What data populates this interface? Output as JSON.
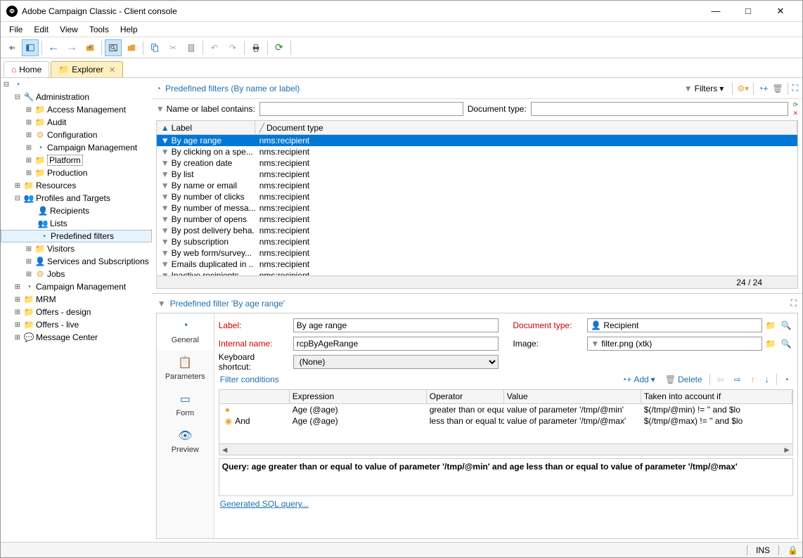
{
  "window": {
    "title": "Adobe Campaign Classic - Client console"
  },
  "menu": {
    "file": "File",
    "edit": "Edit",
    "view": "View",
    "tools": "Tools",
    "help": "Help"
  },
  "tabs": {
    "home": "Home",
    "explorer": "Explorer"
  },
  "tree": {
    "administration": "Administration",
    "access_management": "Access Management",
    "audit": "Audit",
    "configuration": "Configuration",
    "campaign_management": "Campaign Management",
    "platform": "Platform",
    "production": "Production",
    "resources": "Resources",
    "profiles_targets": "Profiles and Targets",
    "recipients": "Recipients",
    "lists": "Lists",
    "predefined_filters": "Predefined filters",
    "visitors": "Visitors",
    "services_subscriptions": "Services and Subscriptions",
    "jobs": "Jobs",
    "campaign_management2": "Campaign Management",
    "mrm": "MRM",
    "offers_design": "Offers - design",
    "offers_live": "Offers - live",
    "message_center": "Message Center"
  },
  "panel": {
    "title": "Predefined filters (By name or label)",
    "filters_btn": "Filters",
    "search_label": "Name or label contains:",
    "doctype_label": "Document type:"
  },
  "list": {
    "col_label": "Label",
    "col_doctype": "Document type",
    "footer_count": "24 / 24",
    "rows": [
      {
        "label": "By age range",
        "doctype": "nms:recipient",
        "selected": true
      },
      {
        "label": "By clicking on a spe...",
        "doctype": "nms:recipient"
      },
      {
        "label": "By creation date",
        "doctype": "nms:recipient"
      },
      {
        "label": "By list",
        "doctype": "nms:recipient"
      },
      {
        "label": "By name or email",
        "doctype": "nms:recipient"
      },
      {
        "label": "By number of clicks",
        "doctype": "nms:recipient"
      },
      {
        "label": "By number of messa...",
        "doctype": "nms:recipient"
      },
      {
        "label": "By number of opens",
        "doctype": "nms:recipient"
      },
      {
        "label": "By post delivery beha..",
        "doctype": "nms:recipient"
      },
      {
        "label": "By subscription",
        "doctype": "nms:recipient"
      },
      {
        "label": "By web form/survey...",
        "doctype": "nms:recipient"
      },
      {
        "label": "Emails duplicated in ..",
        "doctype": "nms:recipient"
      },
      {
        "label": "Inactive recipients",
        "doctype": "nms:recipient"
      }
    ]
  },
  "detail": {
    "header": "Predefined filter 'By age range'",
    "tabs": {
      "general": "General",
      "parameters": "Parameters",
      "form": "Form",
      "preview": "Preview"
    },
    "label_lbl": "Label:",
    "label_val": "By age range",
    "internal_lbl": "Internal name:",
    "internal_val": "rcpByAgeRange",
    "doctype_lbl": "Document type:",
    "doctype_val": "Recipient",
    "image_lbl": "Image:",
    "image_val": "filter.png (xtk)",
    "shortcut_lbl": "Keyboard shortcut:",
    "shortcut_val": "(None)",
    "filter_cond_title": "Filter conditions",
    "add_btn": "Add",
    "delete_btn": "Delete",
    "cond_cols": {
      "andor": "",
      "expr": "Expression",
      "op": "Operator",
      "val": "Value",
      "taken": "Taken into account if"
    },
    "cond_rows": [
      {
        "andor": "",
        "expr": "Age (@age)",
        "op": "greater than or equa",
        "val": "value of parameter '/tmp/@min'",
        "taken": "$(/tmp/@min) != '' and $lo"
      },
      {
        "andor": "And",
        "expr": "Age (@age)",
        "op": "less than or equal to",
        "val": "value of parameter '/tmp/@max'",
        "taken": "$(/tmp/@max) != '' and $lo"
      }
    ],
    "query_text": "Query: age greater than or equal to value of parameter '/tmp/@min' and age less than or equal to value of parameter '/tmp/@max'",
    "sql_link": "Generated SQL query..."
  },
  "status": {
    "ins": "INS"
  }
}
